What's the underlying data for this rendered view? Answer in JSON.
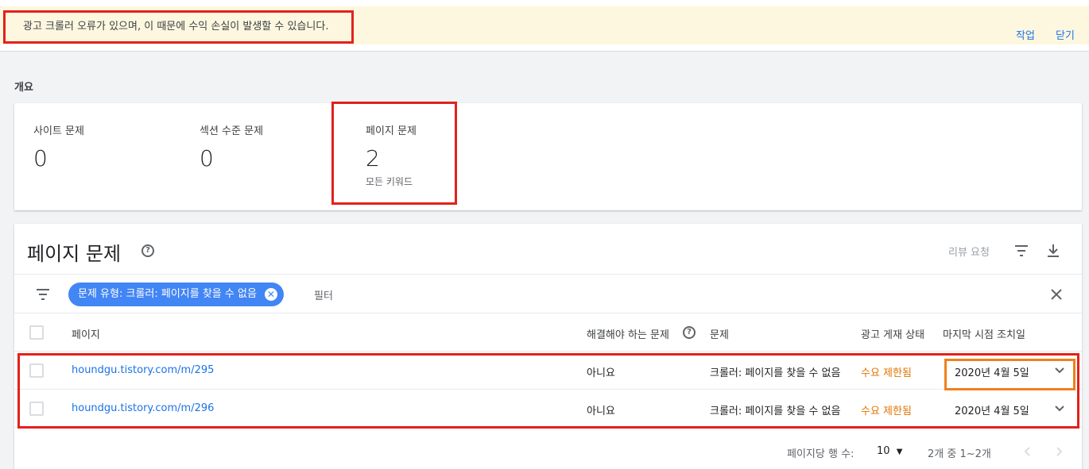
{
  "banner": {
    "message": "광고 크롤러 오류가 있으며, 이 때문에 수익 손실이 발생할 수 있습니다.",
    "action_label": "작업",
    "close_label": "닫기"
  },
  "overview": {
    "label": "개요",
    "stats": [
      {
        "label": "사이트 문제",
        "value": "0"
      },
      {
        "label": "섹션 수준 문제",
        "value": "0"
      },
      {
        "label": "페이지 문제",
        "value": "2",
        "sub": "모든 키워드"
      }
    ]
  },
  "issues": {
    "title": "페이지 문제",
    "review_label": "리뷰 요청",
    "filter_chip": "문제 유형: 크롤러: 페이지를 찾을 수 없음",
    "filter_placeholder": "필터",
    "columns": [
      "페이지",
      "해결해야 하는 문제",
      "문제",
      "광고 게재 상태",
      "마지막 시점 조치일"
    ],
    "rows": [
      {
        "page": "houndgu.tistory.com/m/295",
        "must_fix": "아니요",
        "issue": "크롤러: 페이지를 찾을 수 없음",
        "status": "수요 제한됨",
        "date": "2020년 4월 5일"
      },
      {
        "page": "houndgu.tistory.com/m/296",
        "must_fix": "아니요",
        "issue": "크롤러: 페이지를 찾을 수 없음",
        "status": "수요 제한됨",
        "date": "2020년 4월 5일"
      }
    ],
    "pagination": {
      "rows_label": "페이지당 행 수:",
      "rows_value": "10",
      "range_label": "2개 중 1~2개"
    }
  },
  "colors": {
    "accent": "#1a73e8",
    "chip": "#4285f4",
    "status": "#e37400",
    "annotation_red": "#e2211c",
    "annotation_orange": "#f0801a"
  }
}
